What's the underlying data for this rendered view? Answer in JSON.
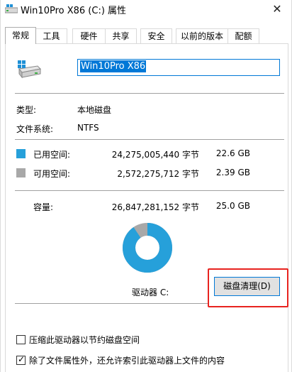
{
  "window": {
    "title": "Win10Pro X86 (C:) 属性",
    "close_glyph": "✕"
  },
  "tabs": [
    {
      "label": "常规"
    },
    {
      "label": "工具"
    },
    {
      "label": "硬件"
    },
    {
      "label": "共享"
    },
    {
      "label": "安全"
    },
    {
      "label": "以前的版本"
    },
    {
      "label": "配额"
    }
  ],
  "active_tab": "常规",
  "drive": {
    "name_value": "Win10Pro X86",
    "type_label": "类型:",
    "type_value": "本地磁盘",
    "fs_label": "文件系统:",
    "fs_value": "NTFS"
  },
  "space": {
    "used_label": "已用空间:",
    "used_bytes": "24,275,005,440 字节",
    "used_size": "22.6 GB",
    "free_label": "可用空间:",
    "free_bytes": "2,572,275,712 字节",
    "free_size": "2.39 GB",
    "capacity_label": "容量:",
    "capacity_bytes": "26,847,281,152 字节",
    "capacity_size": "25.0 GB",
    "used_fraction": 0.904
  },
  "drive_label": "驱动器 C:",
  "cleanup_button": "磁盘清理(D)",
  "options": {
    "compress_label": "压缩此驱动器以节约磁盘空间",
    "compress_checked": false,
    "index_label": "除了文件属性外，还允许索引此驱动器上文件的内容",
    "index_checked": true
  },
  "colors": {
    "used": "#26a0da",
    "free": "#a8a8a8",
    "accent": "#0078d7",
    "highlight": "#e8231f"
  }
}
